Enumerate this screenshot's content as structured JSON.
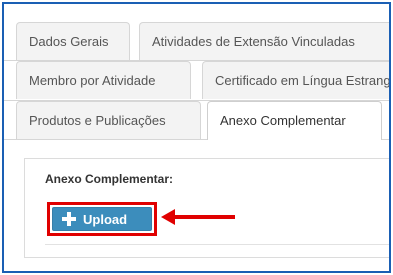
{
  "tabs": {
    "row1": [
      "Dados Gerais",
      "Atividades de Extensão Vinculadas"
    ],
    "row2": [
      "Membro por Atividade",
      "Certificado em Língua Estrangeira"
    ],
    "row3": [
      "Produtos e Publicações",
      "Anexo Complementar"
    ],
    "active": "Anexo Complementar"
  },
  "panel": {
    "label": "Anexo Complementar:",
    "upload_label": "Upload"
  },
  "colors": {
    "frame_border": "#1a5fb4",
    "button_bg": "#3c8dbc",
    "highlight": "#e00000"
  },
  "icons": {
    "upload": "plus-icon",
    "annotation": "arrow-left-icon"
  }
}
